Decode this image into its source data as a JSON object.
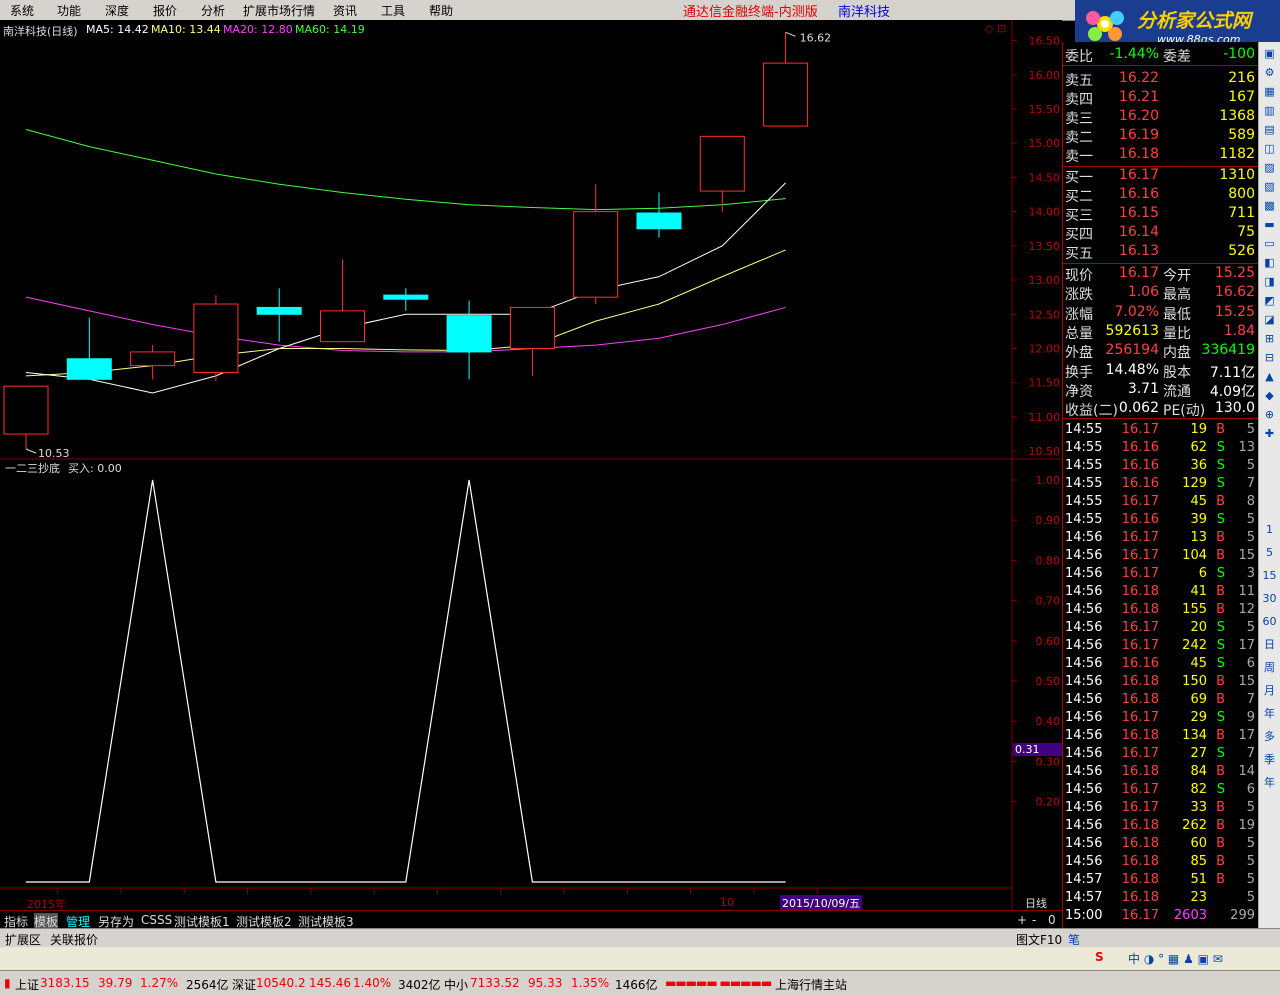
{
  "menu": [
    "系统",
    "功能",
    "深度",
    "报价",
    "分析",
    "扩展市场行情",
    "资讯",
    "工具",
    "帮助"
  ],
  "app_title": "通达信金融终端-内测版",
  "app_stock": "南洋科技",
  "logo": {
    "name": "分析家公式网",
    "url": "www.88gs.com"
  },
  "chart": {
    "title": "南洋科技(日线)",
    "ma5": "MA5: 14.42",
    "ma10": "MA10: 13.44",
    "ma20": "MA20: 12.80",
    "ma60": "MA60: 14.19",
    "high_label": "16.62",
    "low_label": "10.53",
    "price_ticks": [
      "16.50",
      "16.00",
      "15.50",
      "15.00",
      "14.50",
      "14.00",
      "13.50",
      "13.00",
      "12.50",
      "12.00",
      "11.50",
      "11.00",
      "10.50"
    ],
    "indicator_title": "一二三抄底",
    "indicator_value": "买入: 0.00",
    "ind_ticks": [
      "1.00",
      "0.90",
      "0.80",
      "0.70",
      "0.60",
      "0.50",
      "0.40",
      "0.30",
      "0.20"
    ],
    "cursor_value": "0.31",
    "year_label": "2015年",
    "month_label": "10",
    "date_label": "2015/10/09/五",
    "period_label": "日线"
  },
  "chart_data": {
    "type": "candlestick",
    "candles": [
      {
        "o": 10.75,
        "c": 11.45,
        "h": 11.45,
        "l": 10.53
      },
      {
        "o": 11.85,
        "c": 11.55,
        "h": 12.45,
        "l": 11.55
      },
      {
        "o": 11.75,
        "c": 11.95,
        "h": 12.05,
        "l": 11.55
      },
      {
        "o": 11.65,
        "c": 12.65,
        "h": 12.78,
        "l": 11.52
      },
      {
        "o": 12.6,
        "c": 12.5,
        "h": 12.88,
        "l": 12.1
      },
      {
        "o": 12.1,
        "c": 12.55,
        "h": 13.3,
        "l": 12.1
      },
      {
        "o": 12.78,
        "c": 12.72,
        "h": 12.88,
        "l": 12.55
      },
      {
        "o": 12.48,
        "c": 11.95,
        "h": 12.7,
        "l": 11.55
      },
      {
        "o": 12.0,
        "c": 12.6,
        "h": 12.6,
        "l": 11.6
      },
      {
        "o": 12.75,
        "c": 14.0,
        "h": 14.4,
        "l": 12.65
      },
      {
        "o": 13.98,
        "c": 13.75,
        "h": 14.28,
        "l": 13.62
      },
      {
        "o": 14.3,
        "c": 15.1,
        "h": 15.1,
        "l": 14.0
      },
      {
        "o": 15.25,
        "c": 16.17,
        "h": 16.62,
        "l": 15.25
      }
    ],
    "ma5": [
      11.65,
      11.55,
      11.35,
      11.6,
      12.0,
      12.3,
      12.5,
      12.5,
      12.5,
      12.85,
      13.05,
      13.5,
      14.42
    ],
    "ma10": [
      11.6,
      11.65,
      11.75,
      11.9,
      12.0,
      12.0,
      11.98,
      11.97,
      12.05,
      12.4,
      12.65,
      13.05,
      13.44
    ],
    "ma20": [
      12.75,
      12.55,
      12.35,
      12.18,
      12.05,
      11.97,
      11.95,
      11.95,
      12.0,
      12.05,
      12.15,
      12.35,
      12.6
    ],
    "ma60": [
      15.2,
      14.95,
      14.75,
      14.55,
      14.4,
      14.28,
      14.18,
      14.1,
      14.06,
      14.03,
      14.05,
      14.1,
      14.19
    ],
    "indicator": [
      0,
      0,
      1,
      0,
      0,
      0,
      0,
      1,
      0,
      0,
      0,
      0,
      0
    ],
    "price_range": [
      10.4,
      16.8
    ],
    "indicator_range": [
      0,
      1
    ]
  },
  "quote": {
    "weibi_label": "委比",
    "weibi_val": "-1.44%",
    "weicha_label": "委差",
    "weicha_val": "-100",
    "sell": [
      {
        "label": "卖五",
        "price": "16.22",
        "vol": "216"
      },
      {
        "label": "卖四",
        "price": "16.21",
        "vol": "167"
      },
      {
        "label": "卖三",
        "price": "16.20",
        "vol": "1368"
      },
      {
        "label": "卖二",
        "price": "16.19",
        "vol": "589"
      },
      {
        "label": "卖一",
        "price": "16.18",
        "vol": "1182"
      }
    ],
    "buy": [
      {
        "label": "买一",
        "price": "16.17",
        "vol": "1310"
      },
      {
        "label": "买二",
        "price": "16.16",
        "vol": "800"
      },
      {
        "label": "买三",
        "price": "16.15",
        "vol": "711"
      },
      {
        "label": "买四",
        "price": "16.14",
        "vol": "75"
      },
      {
        "label": "买五",
        "price": "16.13",
        "vol": "526"
      }
    ],
    "stats": [
      {
        "l1": "现价",
        "v1": "16.17",
        "c1": "#ff4040",
        "l2": "今开",
        "v2": "15.25",
        "c2": "#ff4040"
      },
      {
        "l1": "涨跌",
        "v1": "1.06",
        "c1": "#ff4040",
        "l2": "最高",
        "v2": "16.62",
        "c2": "#ff4040"
      },
      {
        "l1": "涨幅",
        "v1": "7.02%",
        "c1": "#ff4040",
        "l2": "最低",
        "v2": "15.25",
        "c2": "#ff4040"
      },
      {
        "l1": "总量",
        "v1": "592613",
        "c1": "#ffff00",
        "l2": "量比",
        "v2": "1.84",
        "c2": "#ff4040"
      },
      {
        "l1": "外盘",
        "v1": "256194",
        "c1": "#ff4040",
        "l2": "内盘",
        "v2": "336419",
        "c2": "#00ff00"
      },
      {
        "l1": "换手",
        "v1": "14.48%",
        "c1": "#ffffff",
        "l2": "股本",
        "v2": "7.11亿",
        "c2": "#ffffff"
      },
      {
        "l1": "净资",
        "v1": "3.71",
        "c1": "#ffffff",
        "l2": "流通",
        "v2": "4.09亿",
        "c2": "#ffffff"
      },
      {
        "l1": "收益(二)",
        "v1": "0.062",
        "c1": "#ffffff",
        "l2": "PE(动)",
        "v2": "130.0",
        "c2": "#ffffff"
      }
    ]
  },
  "ticks": [
    {
      "t": "14:55",
      "p": "16.17",
      "v": "19",
      "d": "B",
      "n": "5"
    },
    {
      "t": "14:55",
      "p": "16.16",
      "v": "62",
      "d": "S",
      "n": "13"
    },
    {
      "t": "14:55",
      "p": "16.16",
      "v": "36",
      "d": "S",
      "n": "5"
    },
    {
      "t": "14:55",
      "p": "16.16",
      "v": "129",
      "d": "S",
      "n": "7"
    },
    {
      "t": "14:55",
      "p": "16.17",
      "v": "45",
      "d": "B",
      "n": "8"
    },
    {
      "t": "14:55",
      "p": "16.16",
      "v": "39",
      "d": "S",
      "n": "5"
    },
    {
      "t": "14:56",
      "p": "16.17",
      "v": "13",
      "d": "B",
      "n": "5"
    },
    {
      "t": "14:56",
      "p": "16.17",
      "v": "104",
      "d": "B",
      "n": "15"
    },
    {
      "t": "14:56",
      "p": "16.17",
      "v": "6",
      "d": "S",
      "n": "3"
    },
    {
      "t": "14:56",
      "p": "16.18",
      "v": "41",
      "d": "B",
      "n": "11"
    },
    {
      "t": "14:56",
      "p": "16.18",
      "v": "155",
      "d": "B",
      "n": "12"
    },
    {
      "t": "14:56",
      "p": "16.17",
      "v": "20",
      "d": "S",
      "n": "5"
    },
    {
      "t": "14:56",
      "p": "16.17",
      "v": "242",
      "d": "S",
      "n": "17"
    },
    {
      "t": "14:56",
      "p": "16.16",
      "v": "45",
      "d": "S",
      "n": "6"
    },
    {
      "t": "14:56",
      "p": "16.18",
      "v": "150",
      "d": "B",
      "n": "15"
    },
    {
      "t": "14:56",
      "p": "16.18",
      "v": "69",
      "d": "B",
      "n": "7"
    },
    {
      "t": "14:56",
      "p": "16.17",
      "v": "29",
      "d": "S",
      "n": "9"
    },
    {
      "t": "14:56",
      "p": "16.18",
      "v": "134",
      "d": "B",
      "n": "17"
    },
    {
      "t": "14:56",
      "p": "16.17",
      "v": "27",
      "d": "S",
      "n": "7"
    },
    {
      "t": "14:56",
      "p": "16.18",
      "v": "84",
      "d": "B",
      "n": "14"
    },
    {
      "t": "14:56",
      "p": "16.17",
      "v": "82",
      "d": "S",
      "n": "6"
    },
    {
      "t": "14:56",
      "p": "16.17",
      "v": "33",
      "d": "B",
      "n": "5"
    },
    {
      "t": "14:56",
      "p": "16.18",
      "v": "262",
      "d": "B",
      "n": "19"
    },
    {
      "t": "14:56",
      "p": "16.18",
      "v": "60",
      "d": "B",
      "n": "5"
    },
    {
      "t": "14:56",
      "p": "16.18",
      "v": "85",
      "d": "B",
      "n": "5"
    },
    {
      "t": "14:57",
      "p": "16.18",
      "v": "51",
      "d": "B",
      "n": "5"
    },
    {
      "t": "14:57",
      "p": "16.18",
      "v": "23",
      "d": "",
      "n": "5"
    },
    {
      "t": "15:00",
      "p": "16.17",
      "v": "2603",
      "d": "",
      "n": "299"
    }
  ],
  "bottom_tabs": [
    "指标",
    "模板",
    "管理",
    "另存为",
    "CSSS",
    "测试模板1",
    "测试模板2",
    "测试模板3"
  ],
  "bottom_tabs2": [
    "扩展区",
    "关联报价"
  ],
  "bottom_right": {
    "plus": "+",
    "minus": "-",
    "zero": "0",
    "tuwen": "图文F10",
    "bi": "笔"
  },
  "right_toolbar": [
    "1",
    "5",
    "15",
    "30",
    "60",
    "日",
    "周",
    "月",
    "年",
    "多",
    "季",
    "年"
  ],
  "status": {
    "sh_label": "上证",
    "sh_val": "3183.15",
    "sh_chg": "39.79",
    "sh_pct": "1.27%",
    "sh_amt": "2564亿",
    "sz_label": "深证",
    "sz_val": "10540.2",
    "sz_chg": "145.46",
    "sz_pct": "1.40%",
    "sz_amt": "3402亿",
    "zx_label": "中小",
    "zx_val": "7133.52",
    "zx_chg": "95.33",
    "zx_pct": "1.35%",
    "zx_amt": "1466亿",
    "station": "上海行情主站"
  },
  "colors": {
    "up": "#ff3030",
    "down": "#00ffff",
    "ma5": "#ffffff",
    "ma10": "#ffff80",
    "ma20": "#ff40ff",
    "ma60": "#40ff40",
    "grid": "#800000"
  }
}
